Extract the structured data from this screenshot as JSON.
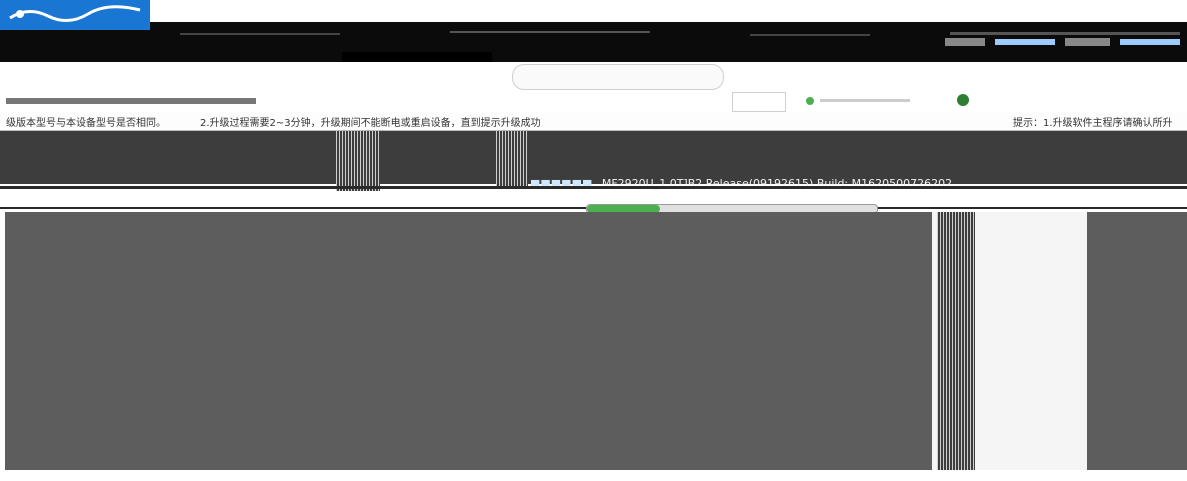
{
  "notice": {
    "requirements_left": "级版本型号与本设备型号是否相同。",
    "requirements_mid": "2.升级过程需要2~3分钟，升级期间不能断电或重启设备，直到提示升级成功",
    "tip_right": "提示：1.升级软件主程序请确认所升"
  },
  "firmware": {
    "version": "MF2920U_1.0T]B2 Release(09192615) Build: M1620500726202"
  },
  "upgrade": {
    "progress": 0.25
  },
  "colors": {
    "brand": "#1976d2",
    "accent": "#4caf50",
    "panel": "#5d5d5d",
    "header": "#0b0b0b"
  }
}
